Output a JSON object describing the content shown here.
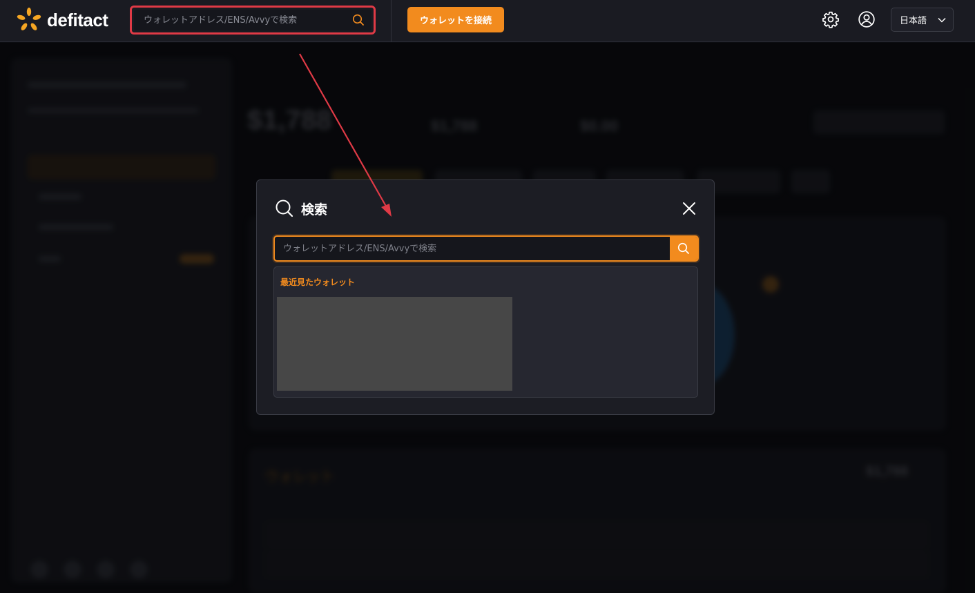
{
  "app": {
    "brand": "defitact"
  },
  "header": {
    "search_placeholder": "ウォレットアドレス/ENS/Avvyで検索",
    "connect_label": "ウォレットを接続",
    "language": "日本語",
    "settings_icon": "gear-icon",
    "account_icon": "user-circle-icon"
  },
  "modal": {
    "title": "検索",
    "search_placeholder": "ウォレットアドレス/ENS/Avvyで検索",
    "recent_title": "最近見たウォレット"
  },
  "colors": {
    "accent": "#f28b1e",
    "highlight_border": "#e03a46",
    "annotation_arrow": "#e03a46"
  }
}
